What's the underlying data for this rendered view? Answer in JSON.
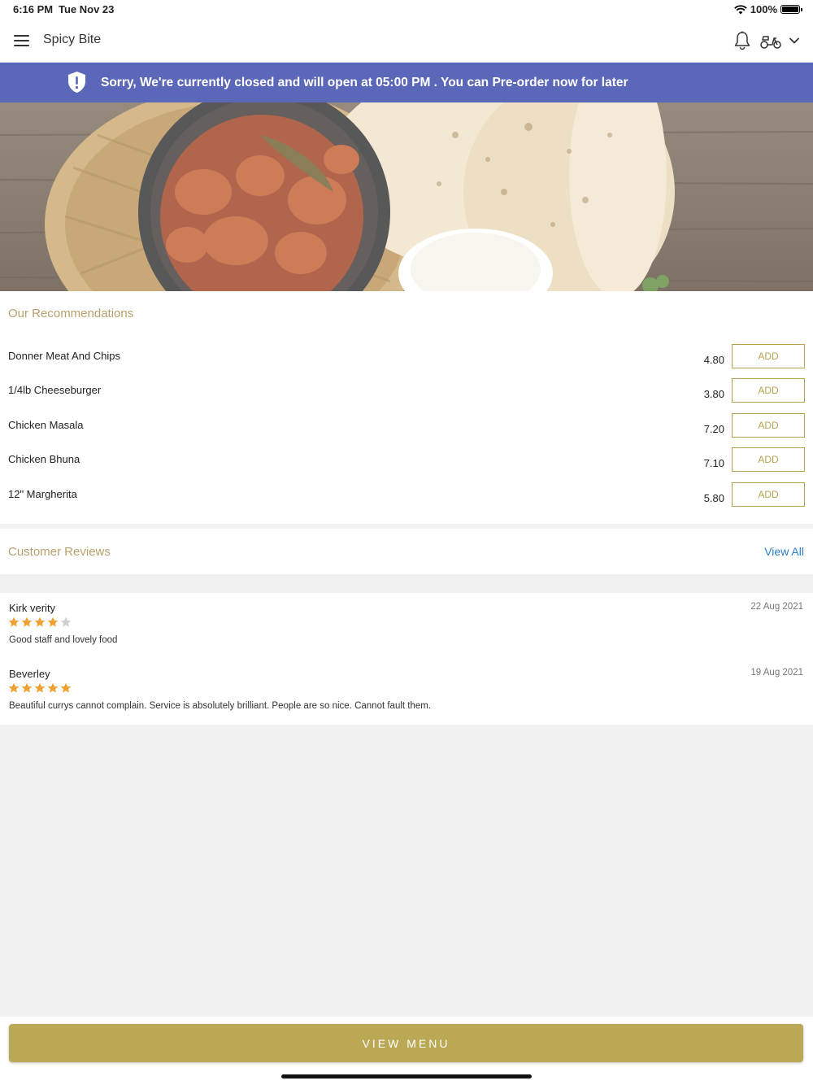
{
  "status_bar": {
    "time": "6:16 PM",
    "date": "Tue Nov 23",
    "battery": "100%"
  },
  "header": {
    "title": "Spicy Bite"
  },
  "banner": {
    "text": "Sorry, We're currently closed and will open at 05:00 PM . You can Pre-order now for later"
  },
  "recommendations": {
    "title": "Our Recommendations",
    "add_label": "ADD",
    "items": [
      {
        "name": "Donner Meat And Chips",
        "price": "4.80"
      },
      {
        "name": "1/4lb Cheeseburger",
        "price": "3.80"
      },
      {
        "name": "Chicken Masala",
        "price": "7.20"
      },
      {
        "name": "Chicken Bhuna",
        "price": "7.10"
      },
      {
        "name": "12\" Margherita",
        "price": "5.80"
      }
    ]
  },
  "reviews": {
    "title": "Customer Reviews",
    "view_all": "View All",
    "items": [
      {
        "name": "Kirk verity",
        "date": "22 Aug 2021",
        "rating": 4,
        "text": "Good staff and lovely food"
      },
      {
        "name": "Beverley",
        "date": "19 Aug 2021",
        "rating": 5,
        "text": "Beautiful currys cannot complain. Service is absolutely brilliant. People are so nice. Cannot fault them."
      }
    ]
  },
  "footer": {
    "view_menu": "VIEW MENU"
  },
  "colors": {
    "banner": "#5b67b8",
    "accent": "#b8a252",
    "star": "#f0a030",
    "link": "#2a7ec6"
  }
}
